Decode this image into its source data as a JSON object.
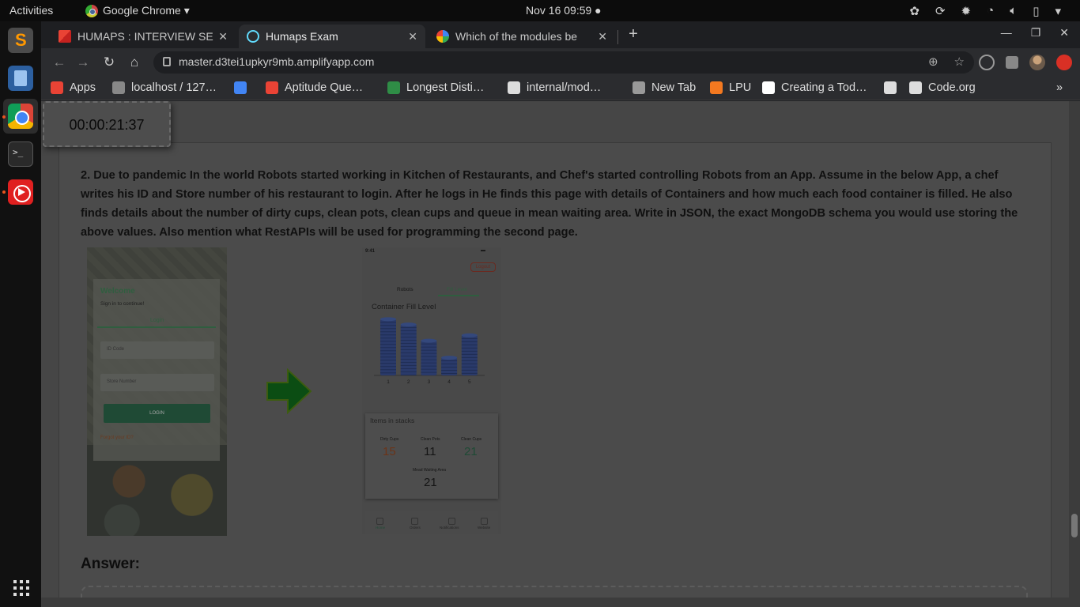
{
  "topbar": {
    "activities": "Activities",
    "app_name": "Google Chrome ▾",
    "clock": "Nov 16  09:59 ●"
  },
  "tabs": [
    {
      "title": "HUMAPS : INTERVIEW SE",
      "icon": "gmail-icon"
    },
    {
      "title": "Humaps Exam",
      "icon": "react-icon"
    },
    {
      "title": "Which of the modules be",
      "icon": "google-icon"
    }
  ],
  "address_bar": {
    "url": "master.d3tei1upkyr9mb.amplifyapp.com"
  },
  "bookmarks": [
    {
      "label": "Apps",
      "color": "#e94335"
    },
    {
      "label": "localhost / 127…",
      "color": "#888888"
    },
    {
      "label": "",
      "color": "#4285f4"
    },
    {
      "label": "Aptitude Que…",
      "color": "#ea4335"
    },
    {
      "label": "Longest Disti…",
      "color": "#2f8d46"
    },
    {
      "label": "internal/mod…",
      "color": "#dddddd"
    },
    {
      "label": "New Tab",
      "color": "#999999"
    },
    {
      "label": "LPU",
      "color": "#f47920"
    },
    {
      "label": "Creating a Tod…",
      "color": "#ffffff"
    },
    {
      "label": "",
      "color": "#dddddd"
    },
    {
      "label": "Code.org",
      "color": "#dddddd"
    }
  ],
  "exam": {
    "timer": "00:00:21:37",
    "question": "2. Due to pandemic In the world Robots started working in Kitchen of Restaurants, and Chef's started controlling Robots from an App. Assume in the below App, a chef writes his ID and Store number of his restaurant to login. After he logs in He finds this page with details of Containers and how much each food container is filled. He also finds details about the number of dirty cups, clean pots, clean cups and queue in mean waiting area. Write in JSON, the exact MongoDB schema you would use storing the above values. Also mention what RestAPIs will be used for programming the second page.",
    "answer_label": "Answer:"
  },
  "login_mockup": {
    "welcome": "Welcome",
    "subtitle": "Sign in to continue!",
    "tab": "Login",
    "id_placeholder": "ID Code",
    "store_placeholder": "Store Number",
    "button": "LOGIN",
    "forgot": "Forgot your ID?"
  },
  "dashboard_mockup": {
    "time": "9:41",
    "logout": "Logout",
    "tab_robots": "Robots",
    "tab_fill": "Fill Level",
    "chart_title": "Container Fill Level",
    "stacks_title": "Items in stacks",
    "stats": [
      {
        "label": "Dirty Cups",
        "value": "15"
      },
      {
        "label": "Clean Pots",
        "value": "11"
      },
      {
        "label": "Clean Cups",
        "value": "21"
      },
      {
        "label": "Mead Waiting Area",
        "value": "21"
      }
    ],
    "nav": [
      "Home",
      "Orders",
      "Notifications",
      "Website"
    ]
  },
  "chart_data": {
    "type": "bar",
    "title": "Container Fill Level",
    "categories": [
      "1",
      "2",
      "3",
      "4",
      "5"
    ],
    "values": [
      73,
      66,
      45,
      23,
      52
    ],
    "ylim": [
      0,
      80
    ],
    "color": "#2a3a6a"
  }
}
